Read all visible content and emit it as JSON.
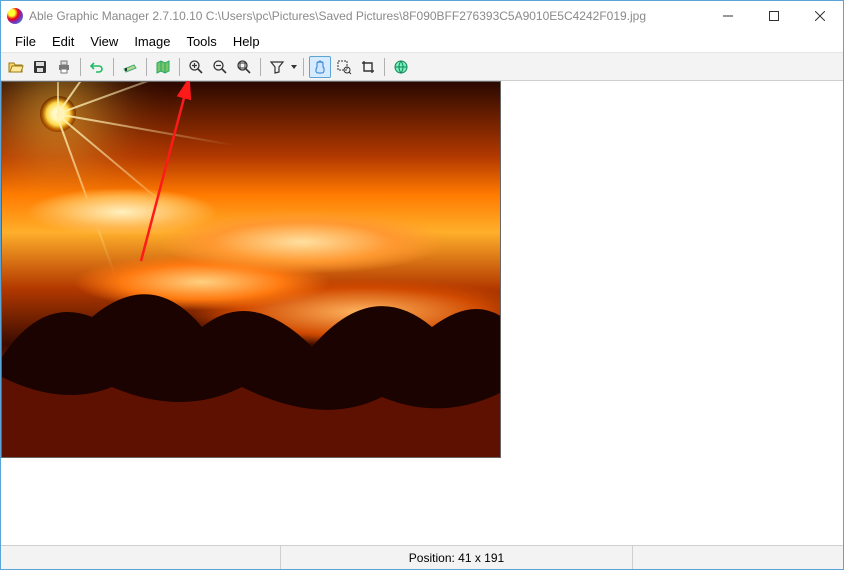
{
  "window": {
    "title": "Able Graphic Manager 2.7.10.10 C:\\Users\\pc\\Pictures\\Saved Pictures\\8F090BFF276393C5A9010E5C4242F019.jpg"
  },
  "menu": {
    "file": "File",
    "edit": "Edit",
    "view": "View",
    "image": "Image",
    "tools": "Tools",
    "help": "Help"
  },
  "toolbar": {
    "open": "open",
    "save": "save",
    "print": "print",
    "undo": "undo",
    "scanner": "scanner",
    "map": "map",
    "zoom_in": "zoom-in",
    "zoom_out": "zoom-out",
    "zoom_fit": "zoom-fit",
    "filter": "filter",
    "hand": "hand",
    "marquee": "marquee",
    "crop": "crop",
    "web": "web"
  },
  "status": {
    "position_label": "Position: 41 x 191"
  }
}
